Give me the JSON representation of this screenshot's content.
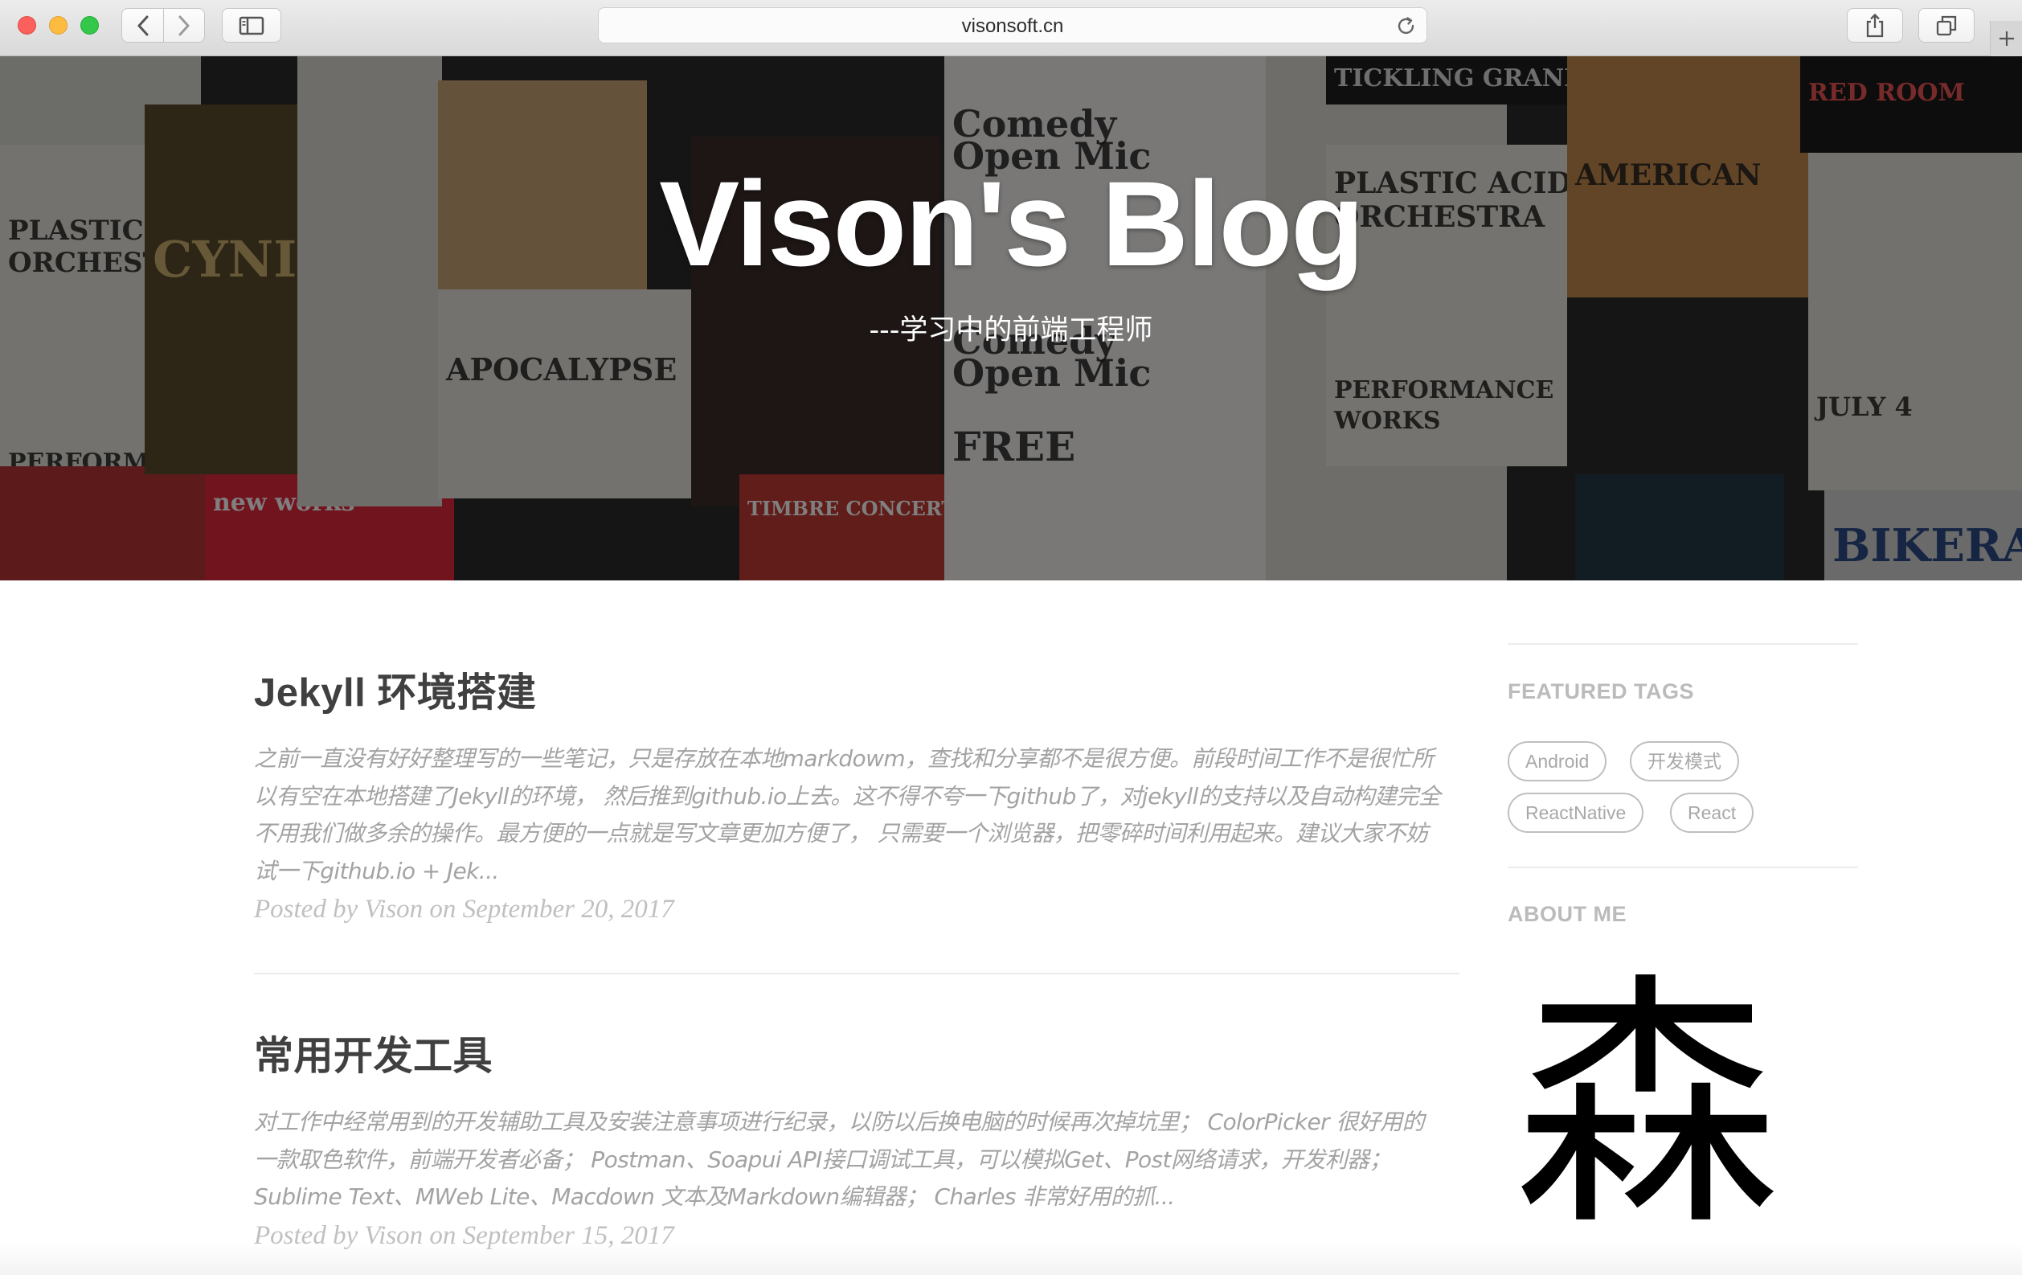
{
  "browser": {
    "url": "visonsoft.cn",
    "icons": {
      "back": "chevron-left-icon",
      "forward": "chevron-right-icon",
      "sidebar": "sidebar-icon",
      "reload": "reload-icon",
      "share": "share-icon",
      "tabs": "tabs-overview-icon",
      "new_tab": "plus-icon"
    }
  },
  "header": {
    "title": "Vison's Blog",
    "subtitle": "---学习中的前端工程师"
  },
  "posts": [
    {
      "title": "Jekyll 环境搭建",
      "excerpt_lines": [
        "之前一直没有好好整理写的一些笔记，只是存放在本地markdowm，查找和分享都不是很方便。前段时间工作不是很忙所",
        "以有空在本地搭建了Jekyll的环境，  然后推到github.io上去。这不得不夸一下github了，对jekyll的支持以及自动构建完全",
        "不用我们做多余的操作。最方便的一点就是写文章更加方便了，  只需要一个浏览器，把零碎时间利用起来。建议大家不妨",
        "试一下github.io + Jek..."
      ],
      "meta": "Posted by Vison on September 20, 2017"
    },
    {
      "title": "常用开发工具",
      "excerpt_lines": [
        "对工作中经常用到的开发辅助工具及安装注意事项进行纪录，以防以后换电脑的时候再次掉坑里；  ColorPicker 很好用的",
        "一款取色软件，前端开发者必备；  Postman、Soapui API接口调试工具，可以模拟Get、Post网络请求，开发利器；",
        "Sublime Text、MWeb Lite、Macdown 文本及Markdown编辑器；  Charles 非常好用的抓..."
      ],
      "meta": "Posted by Vison on September 15, 2017"
    }
  ],
  "sidebar": {
    "featured_tags_heading": "FEATURED TAGS",
    "tags": [
      "Android",
      "开发模式",
      "ReactNative",
      "React"
    ],
    "about_heading": "ABOUT ME",
    "avatar_char": "森"
  },
  "hero_posters": {
    "comedy": "Comedy",
    "open_mic": "Open Mic",
    "plastic_acid": "PLASTIC ACID",
    "orchestra": "ORCHESTRA",
    "performance": "PERFORMANCE",
    "works": "WORKS",
    "american": "AMERICAN",
    "tickling_grandma": "TICKLING GRANDMA",
    "cynic": "CYNIC",
    "free": "FREE",
    "july4": "JULY 4",
    "bikerave": "BIKERAV",
    "red_room": "RED ROOM",
    "new_works": "new works",
    "apocalypse": "APOCALYPSE",
    "timbre": "TIMBRE CONCERTS"
  },
  "colors": {
    "title_text": "#404040",
    "excerpt_text": "#a3a3a3",
    "meta_text": "#c0c0c0",
    "sidebar_heading": "#bbbbbb",
    "tag_border": "#bfbfbf"
  }
}
